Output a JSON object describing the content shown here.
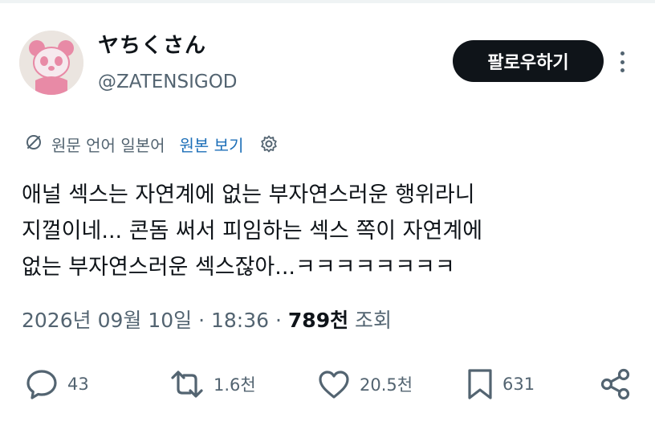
{
  "user": {
    "display_name": "ヤちくさん",
    "handle": "@ZATENSIGOD",
    "follow_label": "팔로우하기"
  },
  "translation": {
    "language_label": "원문 언어 일본어",
    "show_original_label": "원본 보기"
  },
  "tweet": {
    "lines": [
      "애널 섹스는 자연계에 없는 부자연스러운 행위라니",
      "지껄이네... 콘돔 써서 피임하는 섹스 쪽이 자연계에",
      "없는 부자연스러운 섹스잖아...ㅋㅋㅋㅋㅋㅋㅋㅋ"
    ]
  },
  "meta": {
    "date": "2026년 09월 10일",
    "time": "18:36",
    "views_count": "789천",
    "views_label": "조회"
  },
  "actions": {
    "replies": "43",
    "reposts": "1.6천",
    "likes": "20.5천",
    "bookmarks": "631"
  },
  "icons": {
    "more": "more-dots-icon",
    "translate": "no-translate-icon",
    "settings": "gear-icon",
    "reply": "reply-icon",
    "repost": "repost-icon",
    "like": "heart-icon",
    "bookmark": "bookmark-icon",
    "share": "share-icon"
  },
  "colors": {
    "text": "#0f1419",
    "secondary": "#536471",
    "link": "#1d6fb8",
    "button_bg": "#0f1419"
  }
}
